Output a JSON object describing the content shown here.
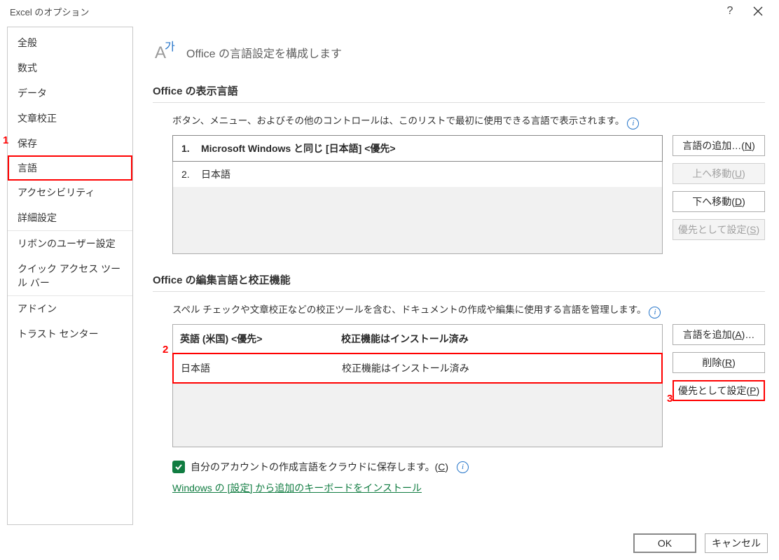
{
  "window": {
    "title": "Excel のオプション"
  },
  "sidebar": {
    "items": [
      {
        "label": "全般"
      },
      {
        "label": "数式"
      },
      {
        "label": "データ"
      },
      {
        "label": "文章校正"
      },
      {
        "label": "保存"
      },
      {
        "label": "言語",
        "selected": true
      },
      {
        "label": "アクセシビリティ"
      },
      {
        "label": "詳細設定"
      },
      {
        "label": "リボンのユーザー設定"
      },
      {
        "label": "クイック アクセス ツール バー"
      },
      {
        "label": "アドイン"
      },
      {
        "label": "トラスト センター"
      }
    ]
  },
  "main": {
    "heading": "Office の言語設定を構成します",
    "display_lang": {
      "title": "Office の表示言語",
      "desc": "ボタン、メニュー、およびその他のコントロールは、このリストで最初に使用できる言語で表示されます。",
      "items": [
        {
          "num": "1.",
          "label": "Microsoft Windows と同じ [日本語] <優先>"
        },
        {
          "num": "2.",
          "label": "日本語"
        }
      ],
      "buttons": {
        "add": "言語の追加…(N)",
        "up": "上へ移動(U)",
        "down": "下へ移動(D)",
        "prefer": "優先として設定(S)"
      }
    },
    "edit_lang": {
      "title": "Office の編集言語と校正機能",
      "desc": "スペル チェックや文章校正などの校正ツールを含む、ドキュメントの作成や編集に使用する言語を管理します。",
      "items": [
        {
          "name": "英語 (米国) <優先>",
          "status": "校正機能はインストール済み"
        },
        {
          "name": "日本語",
          "status": "校正機能はインストール済み"
        }
      ],
      "buttons": {
        "add": "言語を追加(A)…",
        "remove": "削除(R)",
        "prefer": "優先として設定(P)"
      }
    },
    "checkbox": "自分のアカウントの作成言語をクラウドに保存します。(C)",
    "link": "Windows の [設定] から追加のキーボードをインストール"
  },
  "footer": {
    "ok": "OK",
    "cancel": "キャンセル"
  },
  "annot": {
    "one": "1",
    "two": "2",
    "three": "3"
  }
}
